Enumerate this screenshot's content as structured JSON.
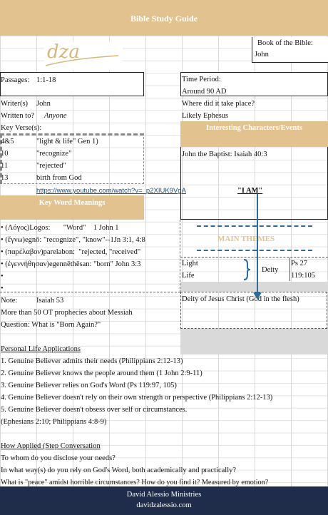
{
  "header": {
    "title": "Bible Study Guide"
  },
  "logo": {
    "text": "dza"
  },
  "book": {
    "label": "Book of the Bible:",
    "value": "John"
  },
  "passages": {
    "label": "Passages:",
    "value": "1:1-18"
  },
  "time_period": {
    "label": "Time Period:",
    "value": "Around 90 AD"
  },
  "writer": {
    "label": "Writer(s)",
    "value": "John"
  },
  "written_to": {
    "label": "Written to?",
    "value": "Anyone"
  },
  "where": {
    "label": "Where did it take place?",
    "value": "Likely Ephesus"
  },
  "key_verses": {
    "label": "Key Verse(s):",
    "rows": [
      {
        "ref": "4&5",
        "text": "\"light & life\" Gen 1)"
      },
      {
        "ref": "10",
        "text": "\"recognize\""
      },
      {
        "ref": "11",
        "text": "\"rejected\""
      },
      {
        "ref": "13",
        "text": "birth from God"
      }
    ],
    "link": "https://www.youtube.com/watch?v=_p2XIUK9VgA"
  },
  "characters": {
    "title": "Interesting Characters/Events",
    "item1": "John the Baptist: Isaiah 40:3",
    "i_am": "\"I AM\""
  },
  "key_words": {
    "title": "Key Word Meanings",
    "items": [
      "• (Λόγος)Logos:       \"Word\"    1 John 1",
      "• (ἔγνω)egnō: \"recognize\", \"know\"--1Jn 3:1, 4:8",
      "• (παρέλαβον)parelabon:  \"rejected, \"received\"",
      "• (ἐγεννήθησαν)egennēthēsan: \"born\" John 3:3",
      "•",
      "•"
    ]
  },
  "main_themes": {
    "title": "MAIN THEMES",
    "left1": "Light",
    "left2": "Life",
    "mid": "Deity",
    "right1": "Ps 27",
    "right2": "119:105",
    "deity": "Deity of Jesus Christ (God in the flesh)"
  },
  "note": {
    "label": "Note:",
    "value": "Isaiah 53",
    "line1": "More than 50 OT prophecies about Messiah",
    "line2": "Question: What is \"Born Again?\""
  },
  "personal": {
    "title": "Personal Life Applications",
    "items": [
      "1. Genuine Believer admits their needs (Philippians  2:12-13)",
      "2. Genuine Believer knows the people around them (1 John 2:9-11)",
      "3. Genuine Believer relies on God's Word (Ps 119:97, 105)",
      "4. Genuine Believer doesn't rely on their own strength or perspective (Philippians  2:12-13)",
      "5. Genuine Believer doesn't obsess over self  or circumstances.",
      "(Ephesians 2:10; Philippians 4:8-9)"
    ]
  },
  "applied": {
    "title": "How Applied (Step Conversation",
    "items": [
      "To whom do you disclose your needs?",
      "In what way(s) do you rely on God's Word, both academically and practically?",
      "What is \"peace\" amidst horrible circumstances? How do you find it? Measured by emotion?"
    ]
  },
  "footer": {
    "line1": "David Alessio Ministries",
    "line2": "davidzalessio.com"
  },
  "colors": {
    "gold": "#e2c38f",
    "navy": "#1f2c4a",
    "arrow": "#2f6b96"
  }
}
